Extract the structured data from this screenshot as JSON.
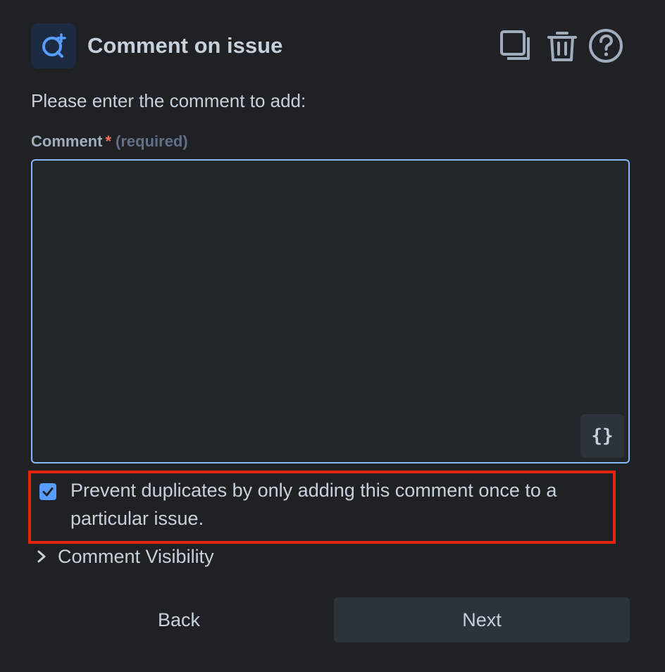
{
  "header": {
    "title": "Comment on issue",
    "icons": {
      "app": "comment-search-icon",
      "copy": "copy-icon",
      "trash": "trash-icon",
      "help": "help-icon"
    }
  },
  "form": {
    "prompt": "Please enter the comment to add:",
    "comment_field": {
      "label": "Comment",
      "required_marker": "*",
      "required_text": "(required)",
      "value": "",
      "insert_variable_icon": "{}"
    },
    "prevent_duplicates": {
      "checked": true,
      "label": "Prevent duplicates by only adding this comment once to a particular issue."
    },
    "visibility_toggle": "Comment Visibility"
  },
  "footer": {
    "back_label": "Back",
    "next_label": "Next"
  },
  "colors": {
    "background": "#1f2125",
    "accent": "#579dff",
    "highlight": "#e2250f",
    "required": "#f87168"
  }
}
